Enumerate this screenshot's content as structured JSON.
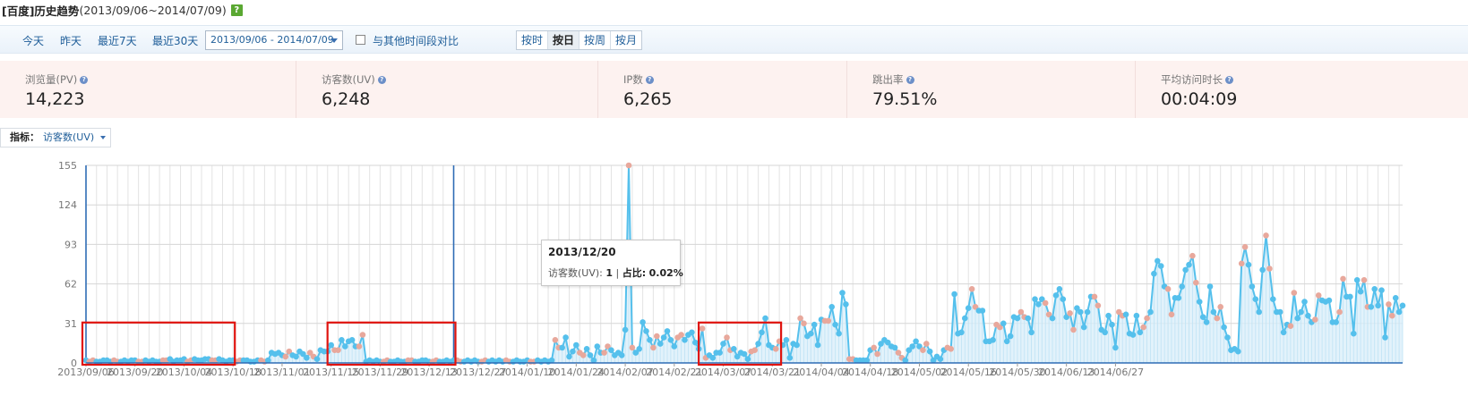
{
  "title": {
    "main": "[百度]历史趋势",
    "range": "(2013/09/06~2014/07/09)",
    "help": "?"
  },
  "toolbar": {
    "quick": [
      "今天",
      "昨天",
      "最近7天",
      "最近30天"
    ],
    "date_range": "2013/09/06 - 2014/07/09",
    "compare_label": "与其他时间段对比",
    "granularity": [
      "按时",
      "按日",
      "按周",
      "按月"
    ],
    "granularity_selected": "按日"
  },
  "stats": [
    {
      "label": "浏览量(PV)",
      "value": "14,223"
    },
    {
      "label": "访客数(UV)",
      "value": "6,248"
    },
    {
      "label": "IP数",
      "value": "6,265"
    },
    {
      "label": "跳出率",
      "value": "79.51%"
    },
    {
      "label": "平均访问时长",
      "value": "00:04:09"
    }
  ],
  "metric": {
    "label": "指标：",
    "value": "访客数(UV)"
  },
  "tooltip": {
    "date": "2013/12/20",
    "series": "访客数(UV):",
    "value": "1",
    "share_label": "占比:",
    "share": "0.02%"
  },
  "colors": {
    "series": "#55c0ec",
    "weekend": "#e8a89c",
    "highlight": "#e0140f",
    "fill": "#d8eef9"
  },
  "chart_data": {
    "type": "area",
    "y_ticks": [
      0,
      31,
      62,
      93,
      124,
      155
    ],
    "ylim": [
      0,
      155
    ],
    "x_ticks": [
      "2013/09/06",
      "2013/09/20",
      "2013/10/04",
      "2013/10/18",
      "2013/11/01",
      "2013/11/15",
      "2013/11/29",
      "2013/12/13",
      "2013/12/27",
      "2014/01/10",
      "2014/01/24",
      "2014/02/07",
      "2014/02/21",
      "2014/03/07",
      "2014/03/21",
      "2014/04/04",
      "2014/04/18",
      "2014/05/02",
      "2014/05/16",
      "2014/05/30",
      "2014/06/13",
      "2014/06/27"
    ],
    "start_date": "2013/09/06",
    "highlighted_ranges": [
      [
        "2013/09/06",
        "2013/10/18"
      ],
      [
        "2013/11/15",
        "2013/12/20"
      ],
      [
        "2014/03/01",
        "2014/03/23"
      ]
    ],
    "vertical_markers": [
      "2013/09/06",
      "2013/12/20"
    ],
    "series": [
      {
        "name": "访客数(UV)",
        "values": [
          2,
          1,
          2,
          1,
          1,
          2,
          2,
          1,
          2,
          1,
          1,
          2,
          1,
          2,
          2,
          1,
          1,
          2,
          1,
          2,
          1,
          1,
          2,
          2,
          3,
          1,
          2,
          2,
          3,
          1,
          2,
          3,
          2,
          2,
          3,
          3,
          2,
          2,
          3,
          2,
          1,
          2,
          2,
          1,
          2,
          2,
          2,
          1,
          1,
          2,
          2,
          1,
          2,
          8,
          7,
          8,
          6,
          5,
          9,
          6,
          5,
          9,
          7,
          4,
          8,
          5,
          3,
          10,
          9,
          9,
          14,
          10,
          10,
          18,
          13,
          17,
          18,
          13,
          13,
          22,
          1,
          2,
          1,
          2,
          1,
          1,
          2,
          1,
          1,
          2,
          1,
          1,
          2,
          2,
          1,
          1,
          2,
          2,
          1,
          1,
          2,
          1,
          1,
          2,
          1,
          2,
          2,
          1,
          1,
          2,
          1,
          2,
          1,
          1,
          2,
          1,
          2,
          1,
          2,
          1,
          2,
          1,
          1,
          2,
          1,
          1,
          2,
          1,
          1,
          2,
          1,
          2,
          1,
          2,
          18,
          12,
          12,
          20,
          5,
          9,
          14,
          8,
          6,
          11,
          6,
          2,
          13,
          8,
          8,
          13,
          10,
          6,
          8,
          6,
          26,
          155,
          12,
          8,
          11,
          32,
          25,
          18,
          12,
          21,
          15,
          20,
          25,
          18,
          13,
          20,
          22,
          18,
          22,
          24,
          16,
          11,
          27,
          4,
          6,
          4,
          8,
          8,
          15,
          20,
          10,
          11,
          5,
          8,
          7,
          3,
          9,
          10,
          15,
          24,
          35,
          14,
          12,
          11,
          17,
          14,
          18,
          4,
          15,
          14,
          35,
          31,
          21,
          23,
          30,
          14,
          34,
          33,
          33,
          44,
          30,
          23,
          55,
          46,
          3,
          3,
          2,
          2,
          2,
          2,
          10,
          12,
          7,
          15,
          18,
          16,
          13,
          12,
          8,
          4,
          2,
          10,
          13,
          17,
          13,
          10,
          15,
          9,
          2,
          5,
          3,
          10,
          12,
          11,
          54,
          23,
          24,
          35,
          43,
          58,
          44,
          41,
          41,
          17,
          17,
          18,
          30,
          28,
          31,
          17,
          21,
          36,
          35,
          40,
          36,
          35,
          24,
          50,
          46,
          50,
          47,
          38,
          35,
          53,
          58,
          50,
          36,
          39,
          26,
          43,
          40,
          28,
          40,
          52,
          52,
          45,
          26,
          24,
          37,
          30,
          12,
          40,
          37,
          38,
          23,
          22,
          37,
          24,
          28,
          35,
          40,
          70,
          80,
          76,
          60,
          58,
          38,
          51,
          51,
          60,
          73,
          77,
          84,
          63,
          48,
          36,
          32,
          60,
          40,
          35,
          44,
          28,
          20,
          10,
          11,
          9,
          78,
          91,
          77,
          60,
          50,
          40,
          73,
          100,
          74,
          50,
          40,
          40,
          24,
          30,
          29,
          55,
          35,
          40,
          48,
          37,
          32,
          34,
          53,
          49,
          48,
          49,
          32,
          32,
          40,
          66,
          52,
          52,
          23,
          65,
          56,
          65,
          44,
          44,
          58,
          45,
          57,
          20,
          46,
          37,
          51,
          40,
          45
        ],
        "weekend_color": "#e8a89c"
      }
    ]
  }
}
